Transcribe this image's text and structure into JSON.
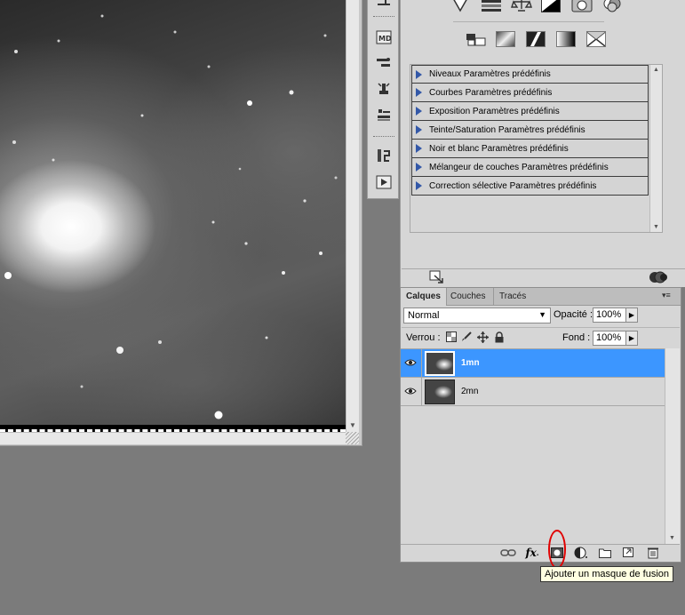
{
  "adjustments": {
    "presets": [
      "Niveaux Paramètres prédéfinis",
      "Courbes Paramètres prédéfinis",
      "Exposition Paramètres prédéfinis",
      "Teinte/Saturation Paramètres prédéfinis",
      "Noir et blanc Paramètres prédéfinis",
      "Mélangeur de couches Paramètres prédéfinis",
      "Correction sélective Paramètres prédéfinis"
    ]
  },
  "layers_panel": {
    "tabs": [
      "Calques",
      "Couches",
      "Tracés"
    ],
    "active_tab": "Calques",
    "blend_mode": "Normal",
    "opacity_label": "Opacité :",
    "opacity_value": "100%",
    "lock_label": "Verrou :",
    "fill_label": "Fond :",
    "fill_value": "100%",
    "layers": [
      {
        "name": "1mn",
        "selected": true,
        "visible": true
      },
      {
        "name": "2mn",
        "selected": false,
        "visible": true
      }
    ],
    "footer_buttons": [
      "link-layers-icon",
      "fx-icon",
      "add-mask-icon",
      "adjustment-layer-icon",
      "group-folder-icon",
      "new-layer-icon",
      "trash-icon"
    ],
    "fx_label": "fx"
  },
  "tooltip": {
    "text": "Ajouter un masque de fusion"
  },
  "colors": {
    "selection": "#3c96ff",
    "highlight_circle": "#e00000",
    "tooltip_bg": "#ffffe1"
  }
}
